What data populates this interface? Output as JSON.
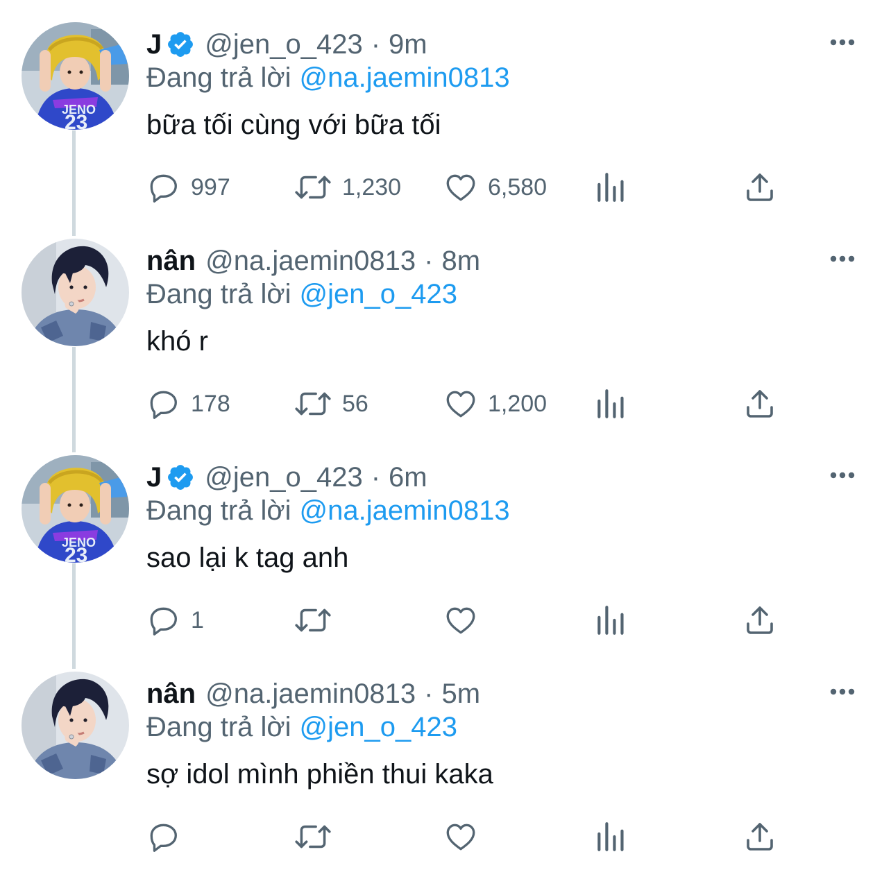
{
  "colors": {
    "text": "#0f1419",
    "secondary": "#536471",
    "accent": "#1d9bf0",
    "thread_line": "#cfd9de"
  },
  "icons": {
    "reply": "speech-bubble-icon",
    "retweet": "retweet-arrows-icon",
    "like": "heart-icon",
    "views": "bar-chart-icon",
    "share": "share-upload-icon",
    "more": "ellipsis-icon",
    "verified": "verified-badge-icon"
  },
  "tweets": [
    {
      "display_name": "J",
      "verified": true,
      "handle": "@jen_o_423",
      "separator": "·",
      "time": "9m",
      "reply_label": "Đang trả lời",
      "reply_to": "@na.jaemin0813",
      "text": "bữa tối cùng với bữa tối",
      "replies": "997",
      "retweets": "1,230",
      "likes": "6,580"
    },
    {
      "display_name": "nân",
      "verified": false,
      "handle": "@na.jaemin0813",
      "separator": "·",
      "time": "8m",
      "reply_label": "Đang trả lời",
      "reply_to": "@jen_o_423",
      "text": "khó r",
      "replies": "178",
      "retweets": "56",
      "likes": "1,200"
    },
    {
      "display_name": "J",
      "verified": true,
      "handle": "@jen_o_423",
      "separator": "·",
      "time": "6m",
      "reply_label": "Đang trả lời",
      "reply_to": "@na.jaemin0813",
      "text": "sao lại k tag anh",
      "replies": "1",
      "retweets": "",
      "likes": ""
    },
    {
      "display_name": "nân",
      "verified": false,
      "handle": "@na.jaemin0813",
      "separator": "·",
      "time": "5m",
      "reply_label": "Đang trả lời",
      "reply_to": "@jen_o_423",
      "text": "sợ idol mình phiền thui kaka",
      "replies": "",
      "retweets": "",
      "likes": ""
    }
  ]
}
